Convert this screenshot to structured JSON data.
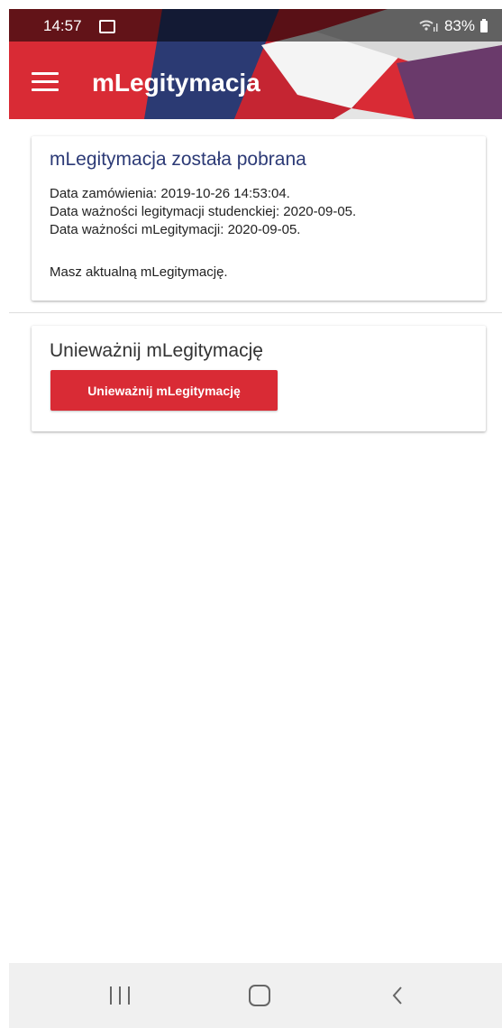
{
  "status_bar": {
    "time": "14:57",
    "battery": "83%"
  },
  "app_bar": {
    "title": "mLegitymacja"
  },
  "download_card": {
    "title": "mLegitymacja została pobrana",
    "order_date": "Data zamówienia: 2019-10-26 14:53:04.",
    "student_id_validity": "Data ważności legitymacji studenckiej: 2020-09-05.",
    "mlegitymacja_validity": "Data ważności mLegitymacji: 2020-09-05.",
    "status": "Masz aktualną mLegitymację."
  },
  "revoke_card": {
    "title": "Unieważnij mLegitymację",
    "button_label": "Unieważnij mLegitymację"
  },
  "icons": {
    "menu": "hamburger-menu-icon",
    "gallery": "image-notification-icon",
    "wifi": "wifi-signal-icon",
    "battery": "battery-icon",
    "recents": "recent-apps-icon",
    "home": "home-icon",
    "back": "back-icon"
  },
  "colors": {
    "brand_red": "#d92b35",
    "title_blue": "#2c3a76",
    "navy": "#2b3a73",
    "nav_bar": "#f0f0f0"
  }
}
